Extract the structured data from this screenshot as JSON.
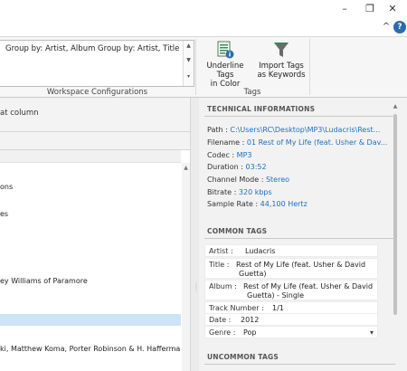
{
  "window": {
    "minimize_glyph": "–",
    "restore_glyph": "❐",
    "close_glyph": "✕"
  },
  "tabrow": {
    "collapse_glyph": "^",
    "help_glyph": "?"
  },
  "ribbon": {
    "workspace_text": "Group by: Artist, Album  Group by: Artist, Title",
    "workspace_group_label": "Workspace Configurations",
    "underline_tags_label_1": "Underline Tags",
    "underline_tags_label_2": "in Color",
    "import_tags_label_1": "Import Tags",
    "import_tags_label_2": "as Keywords",
    "tags_group_label": "Tags",
    "colors": {
      "accent_blue": "#2b6cb0",
      "accent_green": "#2e8b57",
      "filter_grey": "#6b6b6b"
    }
  },
  "left": {
    "hint": "at column",
    "rows": [
      {
        "text": "ons",
        "selected": false
      },
      {
        "text": "es",
        "selected": false
      },
      {
        "text": "ey Williams of Paramore",
        "selected": false
      },
      {
        "text": "",
        "selected": true
      },
      {
        "text": "ki, Matthew Koma, Porter Robinson & H. Hafferma",
        "selected": false
      }
    ]
  },
  "right": {
    "technical": {
      "title": "TECHNICAL INFORMATIONS",
      "items": [
        {
          "label": "Path : ",
          "value": "C:\\Users\\RC\\Desktop\\MP3\\Ludacris\\Rest..."
        },
        {
          "label": "Filename : ",
          "value": "01 Rest of My Life (feat. Usher & Dav..."
        },
        {
          "label": "Codec : ",
          "value": "MP3"
        },
        {
          "label": "Duration : ",
          "value": "03:52"
        },
        {
          "label": "Channel Mode : ",
          "value": "Stereo"
        },
        {
          "label": "Bitrate : ",
          "value": "320 kbps"
        },
        {
          "label": "Sample Rate : ",
          "value": "44,100 Hertz"
        }
      ]
    },
    "common": {
      "title": "COMMON TAGS",
      "artist_label": "Artist :",
      "artist_value": "Ludacris",
      "title_label": "Title :",
      "title_value_1": "Rest of My Life (feat. Usher & David",
      "title_value_2": "Guetta)",
      "album_label": "Album :",
      "album_value_1": "Rest of My Life (feat. Usher & David",
      "album_value_2": "Guetta) - Single",
      "track_label": "Track Number :",
      "track_value": "1/1",
      "date_label": "Date :",
      "date_value": "2012",
      "genre_label": "Genre :",
      "genre_value": "Pop",
      "dropdown_glyph": "▾"
    },
    "uncommon": {
      "title": "UNCOMMON TAGS"
    }
  }
}
